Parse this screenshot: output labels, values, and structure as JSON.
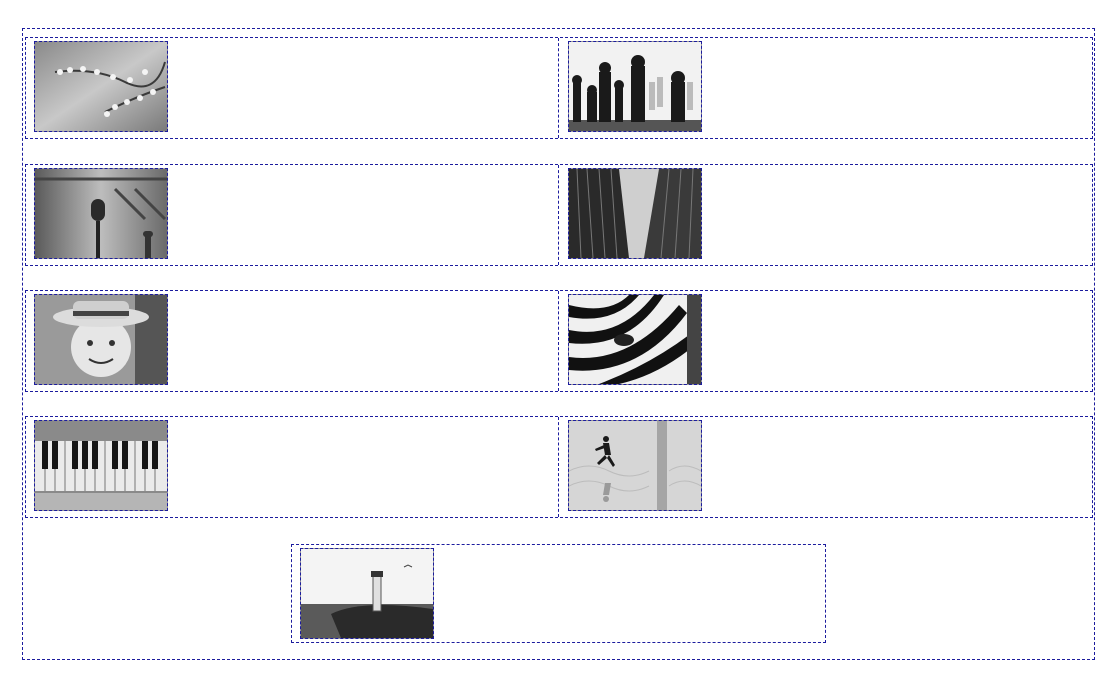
{
  "gallery": {
    "rows": [
      [
        {
          "subject": "cherry-blossom-branch",
          "icon": "cherry-blossom-icon"
        },
        {
          "subject": "chess-pieces",
          "icon": "chess-icon"
        }
      ],
      [
        {
          "subject": "vintage-microphone",
          "icon": "microphone-icon"
        },
        {
          "subject": "skyscrapers-looking-up",
          "icon": "skyscraper-icon"
        }
      ],
      [
        {
          "subject": "smiling-boy-with-hat",
          "icon": "portrait-icon"
        },
        {
          "subject": "zebra-closeup",
          "icon": "zebra-icon"
        }
      ],
      [
        {
          "subject": "old-piano-keys",
          "icon": "piano-icon"
        },
        {
          "subject": "runner-on-glass-floor",
          "icon": "runner-icon"
        }
      ]
    ],
    "final": {
      "subject": "lighthouse-on-jetty",
      "icon": "lighthouse-icon"
    }
  },
  "colors": {
    "border": "#1c1c9e",
    "background": "#ffffff"
  }
}
